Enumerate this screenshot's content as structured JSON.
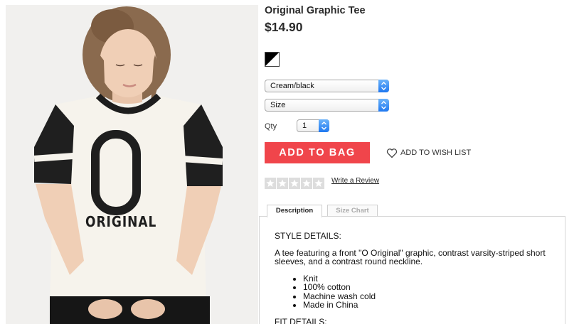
{
  "product": {
    "title": "Original Graphic Tee",
    "price": "$14.90",
    "image_alt": "Model wearing cream and black varsity tee with O Original graphic",
    "graphic_text": "ORIGINAL",
    "graphic_letter": "O"
  },
  "swatch": {
    "colors": [
      "#000000",
      "#ffffff"
    ]
  },
  "selects": {
    "color_value": "Cream/black",
    "size_value": "Size",
    "qty_label": "Qty",
    "qty_value": "1"
  },
  "actions": {
    "add_to_bag": "ADD TO BAG",
    "add_to_wishlist": "ADD TO WISH LIST"
  },
  "reviews": {
    "rating": 0,
    "max_stars": 5,
    "write_review": "Write a Review"
  },
  "tabs": [
    {
      "label": "Description",
      "active": true
    },
    {
      "label": "Size Chart",
      "active": false
    }
  ],
  "description": {
    "heading": "STYLE DETAILS:",
    "body": "A tee featuring a front \"O Original\" graphic, contrast varsity-striped short sleeves, and a contrast round neckline.",
    "bullets": [
      "Knit",
      "100% cotton",
      "Machine wash cold",
      "Made in China"
    ],
    "fit_heading": "FIT DETAILS:"
  },
  "colors": {
    "button_red": "#f0454b",
    "select_blue": "#1f78f0",
    "star_bg": "#dddddd"
  }
}
